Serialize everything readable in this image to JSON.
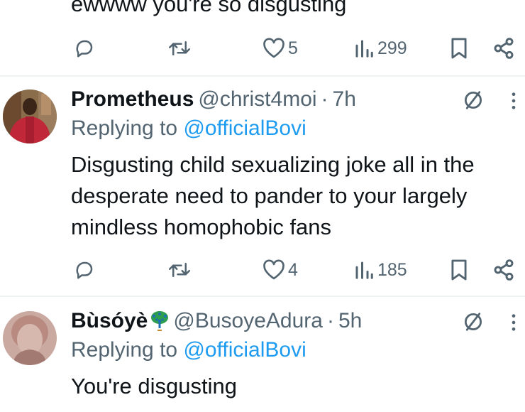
{
  "tweet0": {
    "text": "ewwww you're so disgusting",
    "likes": "5",
    "views": "299"
  },
  "tweet1": {
    "name": "Prometheus",
    "handle": "@christ4moi",
    "separator": "·",
    "time": "7h",
    "replying_label": "Replying to",
    "replying_to": "@officialBovi",
    "text": "Disgusting child sexualizing joke all in the desperate need to pander to your largely mindless homophobic fans",
    "likes": "4",
    "views": "185"
  },
  "tweet2": {
    "name": "Bùsóyè",
    "handle": "@BusoyeAdura",
    "separator": "·",
    "time": "5h",
    "replying_label": "Replying to",
    "replying_to": "@officialBovi",
    "text": "You're disgusting",
    "name_emoji": "peacock-icon"
  },
  "colors": {
    "text": "#0f1419",
    "secondary": "#536471",
    "link": "#1d9bf0",
    "divider": "#eff3f4"
  },
  "icons": [
    "reply-icon",
    "retweet-icon",
    "like-icon",
    "views-icon",
    "bookmark-icon",
    "share-icon",
    "grok-icon",
    "more-icon"
  ]
}
